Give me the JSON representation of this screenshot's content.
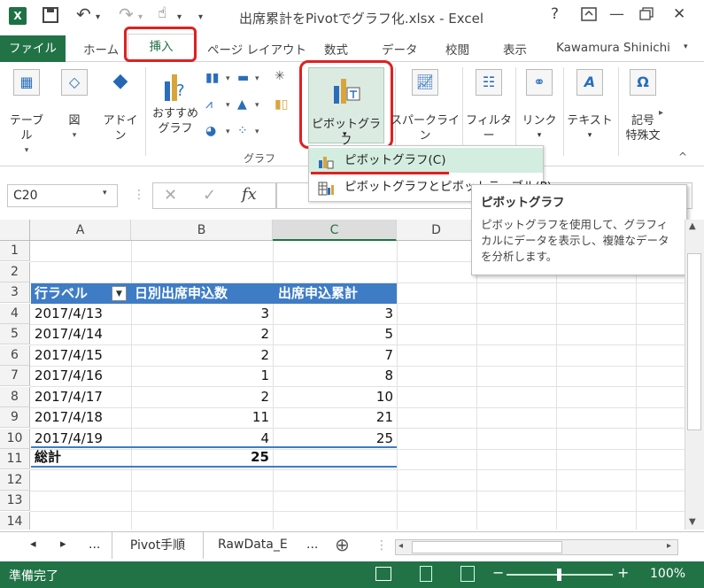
{
  "window": {
    "app_letter": "X",
    "title": "出席累計をPivotでグラフ化.xlsx - Excel",
    "help": "?",
    "minimize": "—",
    "close": "✕",
    "dropdown_mark": "▾",
    "undo": "↶",
    "redo": "↷",
    "touch": "☝"
  },
  "tabs": {
    "file": "ファイル",
    "home": "ホーム",
    "insert": "挿入",
    "page_layout": "ページ レイアウト",
    "formulas": "数式",
    "data": "データ",
    "review": "校閲",
    "view": "表示",
    "user": "Kawamura Shinichi"
  },
  "ribbon": {
    "table": "テーブル",
    "illustrations": "図",
    "addin_1": "アドイ",
    "addin_2": "ン",
    "recommended_1": "おすすめ",
    "recommended_2": "グラフ",
    "pivot_chart": "ピボットグラフ",
    "sparkline": "スパークライン",
    "filter": "フィルター",
    "link": "リンク",
    "text": "テキスト",
    "symbol_1": "記号",
    "symbol_2": "特殊文",
    "group_charts": "グラフ",
    "collapse": "^"
  },
  "dropdown": {
    "item1": "ピボットグラフ(C)",
    "item2": "ピボットグラフとピボットテーブル(P)"
  },
  "tooltip": {
    "title": "ピボットグラフ",
    "body": "ピボットグラフを使用して、グラフィカルにデータを表示し、複雑なデータを分析します。"
  },
  "formula_bar": {
    "name_box": "C20",
    "cancel": "✕",
    "enter": "✓",
    "fx": "fx"
  },
  "sheet": {
    "columns": [
      "A",
      "B",
      "C",
      "D"
    ],
    "rows": [
      "1",
      "2",
      "3",
      "4",
      "5",
      "6",
      "7",
      "8",
      "9",
      "10",
      "11",
      "12",
      "13",
      "14"
    ],
    "header": {
      "a": "行ラベル",
      "b": "日別出席申込数",
      "c": "出席申込累計"
    },
    "data": [
      {
        "date": "2017/4/13",
        "daily": "3",
        "cum": "3"
      },
      {
        "date": "2017/4/14",
        "daily": "2",
        "cum": "5"
      },
      {
        "date": "2017/4/15",
        "daily": "2",
        "cum": "7"
      },
      {
        "date": "2017/4/16",
        "daily": "1",
        "cum": "8"
      },
      {
        "date": "2017/4/17",
        "daily": "2",
        "cum": "10"
      },
      {
        "date": "2017/4/18",
        "daily": "11",
        "cum": "21"
      },
      {
        "date": "2017/4/19",
        "daily": "4",
        "cum": "25"
      }
    ],
    "total_label": "総計",
    "total_value": "25"
  },
  "sheet_tabs": {
    "prev": "◂",
    "next": "▸",
    "more": "...",
    "tab1": "Pivot手順",
    "tab2": "RawData_E",
    "more2": "...",
    "add": "⊕"
  },
  "status": {
    "ready": "準備完了",
    "zoom_minus": "−",
    "zoom_plus": "+",
    "zoom": "100%"
  }
}
